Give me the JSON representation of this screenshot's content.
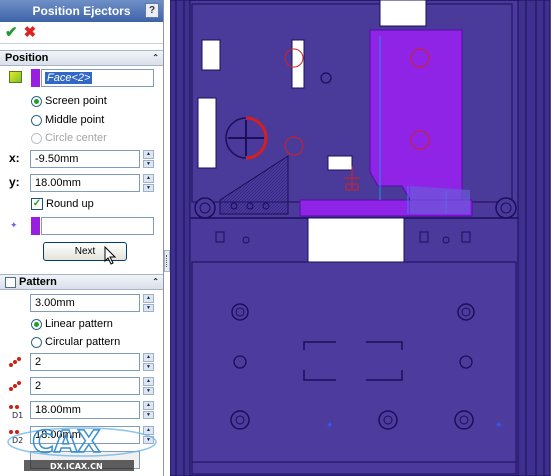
{
  "panel": {
    "title": "Position Ejectors",
    "help_label": "?",
    "ok_icon": "checkmark-icon",
    "cancel_icon": "x-icon"
  },
  "position": {
    "header": "Position",
    "face_selection": "Face<2>",
    "radio_screen_point": "Screen point",
    "radio_middle_point": "Middle point",
    "radio_circle_center": "Circle center",
    "selected_radio": "Screen point",
    "x_label": "x:",
    "x_value": "-9.50mm",
    "y_label": "y:",
    "y_value": "18.00mm",
    "round_up_label": "Round up",
    "round_up_checked": true,
    "second_selection": "",
    "next_button": "Next"
  },
  "pattern": {
    "header": "Pattern",
    "enabled": false,
    "value": "3.00mm",
    "radio_linear": "Linear pattern",
    "radio_circular": "Circular pattern",
    "selected_radio": "Linear pattern",
    "count_1": "2",
    "count_2": "2",
    "d1_value": "18.00mm",
    "d2_value": "18.00mm"
  },
  "watermark": {
    "text": "CAX",
    "url": "DX.ICAX.CN"
  },
  "colors": {
    "model_fill": "#4b3a9c",
    "model_edge": "#1a0f5a",
    "selected_face": "#8f24e6",
    "accent_red": "#d42020",
    "title_bar": "#3d63a8"
  }
}
